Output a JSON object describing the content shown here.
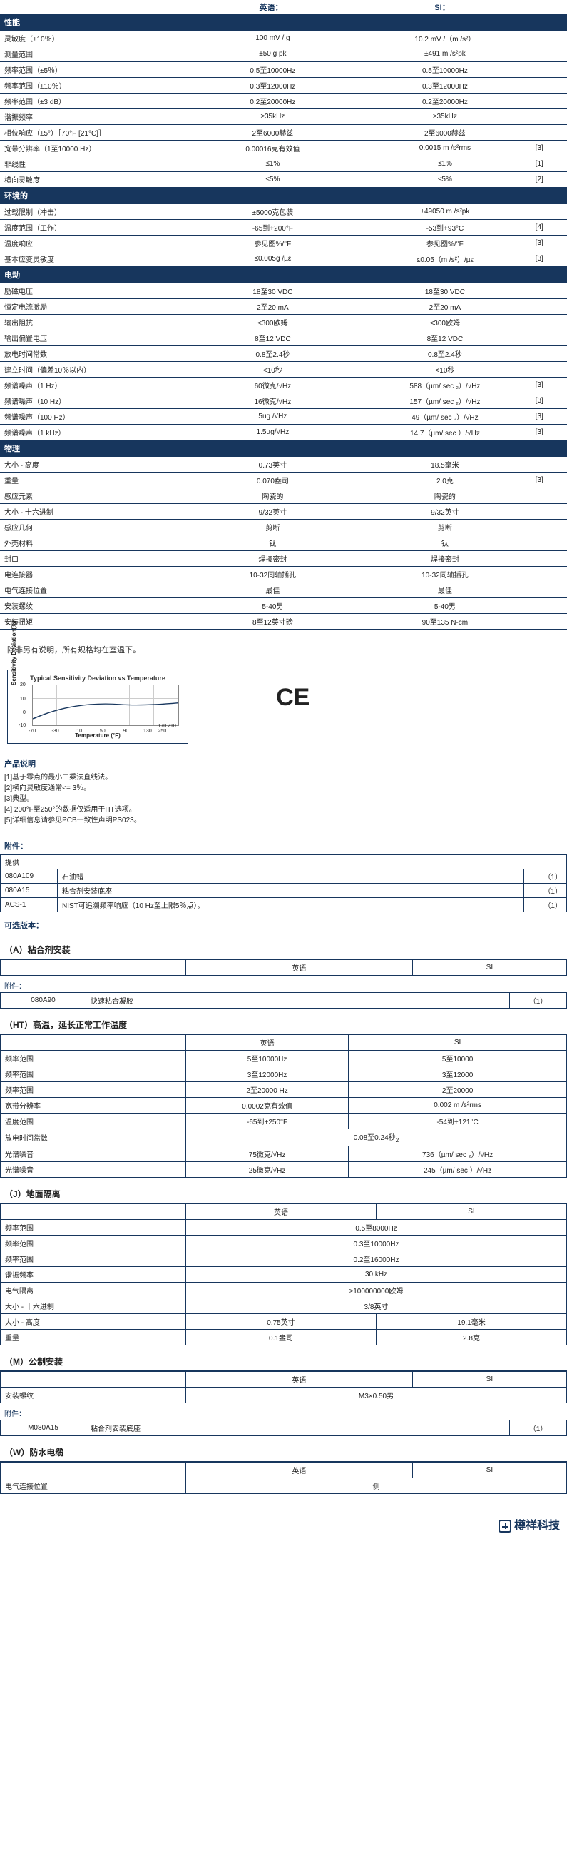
{
  "hdr_en": "英语：",
  "hdr_si": "SI：",
  "sections": [
    {
      "title": "性能",
      "rows": [
        {
          "p": "灵敏度（±10％）",
          "en": "100 mV / g",
          "si": "10.2 mV /（m /s²）",
          "n": ""
        },
        {
          "p": "测量范围",
          "en": "±50 g pk",
          "si": "±491 m /s²pk",
          "n": ""
        },
        {
          "p": "频率范围（±5％）",
          "en": "0.5至10000Hz",
          "si": "0.5至10000Hz",
          "n": ""
        },
        {
          "p": "频率范围（±10％）",
          "en": "0.3至12000Hz",
          "si": "0.3至12000Hz",
          "n": ""
        },
        {
          "p": "频率范围（±3 dB）",
          "en": "0.2至20000Hz",
          "si": "0.2至20000Hz",
          "n": ""
        },
        {
          "p": "谐振频率",
          "en": "≥35kHz",
          "si": "≥35kHz",
          "n": ""
        },
        {
          "p": "相位响应（±5°）［70°F [21°C]］",
          "en": "2至6000赫兹",
          "si": "2至6000赫兹",
          "n": ""
        },
        {
          "p": "宽带分辨率（1至10000 Hz）",
          "en": "0.00016克有效值",
          "si": "0.0015 m /s²rms",
          "n": "[3]"
        },
        {
          "p": "非线性",
          "en": "≤1%",
          "si": "≤1%",
          "n": "[1]"
        },
        {
          "p": "横向灵敏度",
          "en": "≤5%",
          "si": "≤5%",
          "n": "[2]"
        }
      ]
    },
    {
      "title": "环境的",
      "rows": [
        {
          "p": "过载限制（冲击）",
          "en": "±5000克包装",
          "si": "±49050 m /s²pk",
          "n": ""
        },
        {
          "p": "温度范围（工作）",
          "en": "-65到+200°F",
          "si": "-53到+93°C",
          "n": "[4]"
        },
        {
          "p": "温度响应",
          "en": "参见图%/°F",
          "si": "参见图%/°F",
          "n": "[3]"
        },
        {
          "p": "基本应变灵敏度",
          "en": "≤0.005g /µε",
          "si": "≤0.05（m /s²）/µε",
          "n": "[3]"
        }
      ]
    },
    {
      "title": "电动",
      "rows": [
        {
          "p": "励磁电压",
          "en": "18至30 VDC",
          "si": "18至30 VDC",
          "n": ""
        },
        {
          "p": "恒定电流激励",
          "en": "2至20 mA",
          "si": "2至20 mA",
          "n": ""
        },
        {
          "p": "输出阻抗",
          "en": "≤300欧姆",
          "si": "≤300欧姆",
          "n": ""
        },
        {
          "p": "输出偏置电压",
          "en": "8至12 VDC",
          "si": "8至12 VDC",
          "n": ""
        },
        {
          "p": "放电时间常数",
          "en": "0.8至2.4秒",
          "si": "0.8至2.4秒",
          "n": ""
        },
        {
          "p": "建立时间（偏差10％以内）",
          "en": "<10秒",
          "si": "<10秒",
          "n": ""
        },
        {
          "p": "频谱噪声（1 Hz）",
          "en": "60微克/√Hz",
          "si": "588（µm/ sec ₂）/√Hz",
          "n": "[3]"
        },
        {
          "p": "频谱噪声（10 Hz）",
          "en": "16微克/√Hz",
          "si": "157（µm/ sec ₂）/√Hz",
          "n": "[3]"
        },
        {
          "p": "频谱噪声（100 Hz）",
          "en": "5ug /√Hz",
          "si": "49（µm/ sec ₂）/√Hz",
          "n": "[3]"
        },
        {
          "p": "频谱噪声（1 kHz）",
          "en": "1.5µg/√Hz",
          "si": "14.7（µm/ sec ）/√Hz",
          "n": "[3]"
        }
      ]
    },
    {
      "title": "物理",
      "rows": [
        {
          "p": "大小 - 高度",
          "en": "0.73英寸",
          "si": "18.5毫米",
          "n": ""
        },
        {
          "p": "重量",
          "en": "0.070盎司",
          "si": "2.0克",
          "n": "[3]"
        },
        {
          "p": "感应元素",
          "en": "陶瓷的",
          "si": "陶瓷的",
          "n": ""
        },
        {
          "p": "大小 - 十六进制",
          "en": "9/32英寸",
          "si": "9/32英寸",
          "n": ""
        },
        {
          "p": "感应几何",
          "en": "剪断",
          "si": "剪断",
          "n": ""
        },
        {
          "p": "外壳材料",
          "en": "钛",
          "si": "钛",
          "n": ""
        },
        {
          "p": "封口",
          "en": "焊接密封",
          "si": "焊接密封",
          "n": ""
        },
        {
          "p": "电连接器",
          "en": "10-32同轴插孔",
          "si": "10-32同轴插孔",
          "n": ""
        },
        {
          "p": "电气连接位置",
          "en": "最佳",
          "si": "最佳",
          "n": ""
        },
        {
          "p": "安装螺纹",
          "en": "5-40男",
          "si": "5-40男",
          "n": ""
        },
        {
          "p": "安装扭矩",
          "en": "8至12英寸磅",
          "si": "90至135 N-cm",
          "n": ""
        }
      ]
    }
  ],
  "room_temp": "除非另有说明，所有规格均在室温下。",
  "chart": {
    "title": "Typical Sensitivity Deviation vs Temperature",
    "xlabel": "Temperature (°F)",
    "ylabel": "Sensitivity Deviation(%)"
  },
  "prod_notes_h": "产品说明",
  "prod_notes": [
    "[1]基于零点的最小二乘法直线法。",
    "[2]横向灵敏度通常<= 3％。",
    "[3]典型。",
    "[4] 200°F至250°的数据仅适用于HT选项。",
    "[5]详细信息请参见PCB一致性声明PS023。"
  ],
  "acc_h": "附件：",
  "acc_sub": "提供",
  "acc": [
    {
      "a": "080A109",
      "b": "石油蜡",
      "c": "（1）"
    },
    {
      "a": "080A15",
      "b": "粘合剂安装底座",
      "c": "（1）"
    },
    {
      "a": "ACS-1",
      "b": "NIST可追溯频率响应（10 Hz至上限5％点）。",
      "c": "（1）"
    }
  ],
  "opt_h": "可选版本：",
  "optA": {
    "head": "（A）粘合剂安装",
    "en": "英语",
    "si": "SI",
    "att_lab": "附件：",
    "att": {
      "a": "080A90",
      "b": "快速粘合凝胶",
      "c": "（1）"
    }
  },
  "optHT": {
    "head": "（HT）高温，延长正常工作温度",
    "en": "英语",
    "si": "SI",
    "rows": [
      {
        "p": "频率范围",
        "en": "5至10000Hz",
        "si": "5至10000"
      },
      {
        "p": "频率范围",
        "en": "3至12000Hz",
        "si": "3至12000"
      },
      {
        "p": "频率范围",
        "en": "2至20000 Hz",
        "si": "2至20000"
      },
      {
        "p": "宽带分辨率",
        "en": "0.0002克有效值",
        "si": "0.002 m /s²rms"
      },
      {
        "p": "温度范围",
        "en": "-65到+250°F",
        "si": "-54到+121°C"
      },
      {
        "p": "放电时间常数",
        "en": "0.08至0.24秒",
        "si": "",
        "span": true,
        "sub": "2"
      },
      {
        "p": "光谱噪音",
        "en": "75微克/√Hz",
        "si": "736（µm/ sec ₂）/√Hz"
      },
      {
        "p": "光谱噪音",
        "en": "25微克/√Hz",
        "si": "245（µm/ sec ）/√Hz"
      }
    ]
  },
  "optJ": {
    "head": "（J）地面隔离",
    "en": "英语",
    "si": "SI",
    "rows": [
      {
        "p": "频率范围",
        "en": "0.5至8000Hz",
        "si": "",
        "span": true
      },
      {
        "p": "频率范围",
        "en": "0.3至10000Hz",
        "si": "",
        "span": true
      },
      {
        "p": "频率范围",
        "en": "0.2至16000Hz",
        "si": "",
        "span": true
      },
      {
        "p": "谐振频率",
        "en": "30 kHz",
        "si": "",
        "span": true
      },
      {
        "p": "电气隔离",
        "en": "≥100000000欧姆",
        "si": "",
        "span": true
      },
      {
        "p": "大小 - 十六进制",
        "en": "3/8英寸",
        "si": "",
        "span": true
      },
      {
        "p": "大小 - 高度",
        "en": "0.75英寸",
        "si": "19.1毫米"
      },
      {
        "p": "重量",
        "en": "0.1盎司",
        "si": "2.8克"
      }
    ]
  },
  "optM": {
    "head": "（M）公制安装",
    "en": "英语",
    "si": "SI",
    "rows": [
      {
        "p": "安装螺纹",
        "en": "M3×0.50男",
        "si": "",
        "span": true
      }
    ],
    "att_lab": "附件：",
    "att": {
      "a": "M080A15",
      "b": "粘合剂安装底座",
      "c": "（1）"
    }
  },
  "optW": {
    "head": "（W）防水电缆",
    "en": "英语",
    "si": "SI",
    "rows": [
      {
        "p": "电气连接位置",
        "en": "侧",
        "si": "",
        "span": true
      }
    ]
  },
  "footer": "樽祥科技"
}
